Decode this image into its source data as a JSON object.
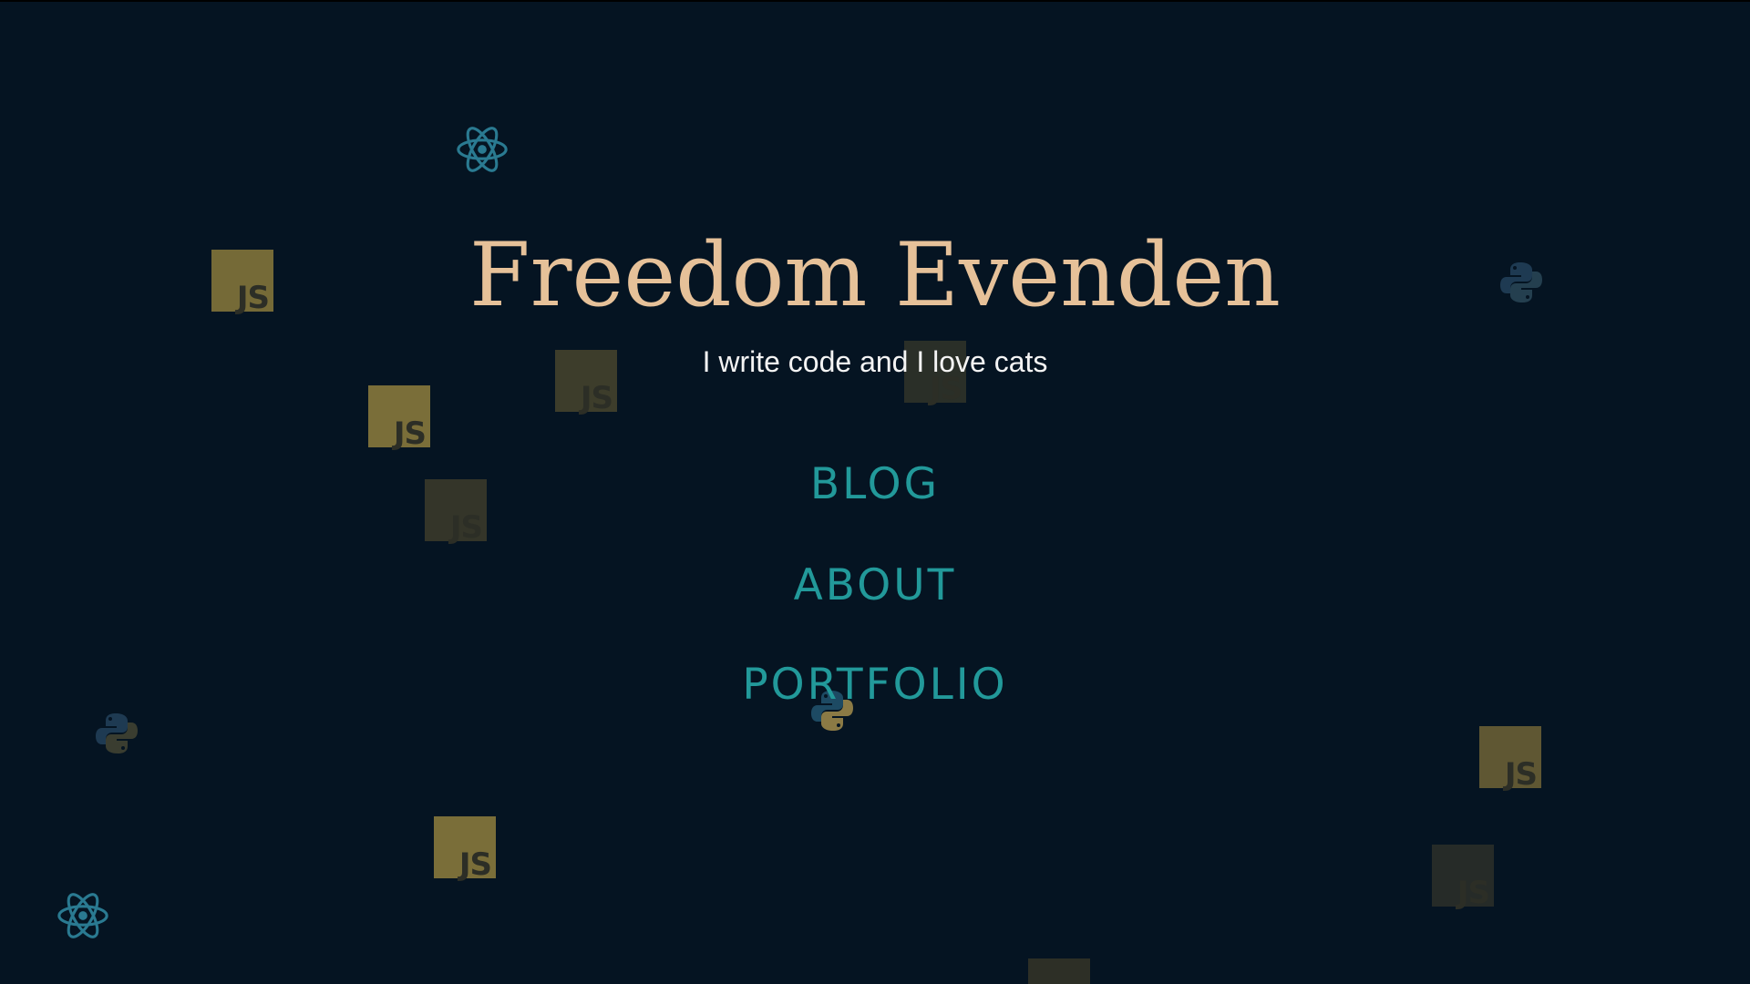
{
  "page": {
    "background_color": "#051422"
  },
  "header": {
    "title": "Freedom Evenden",
    "tagline": "I write code and I love cats"
  },
  "nav": {
    "items": [
      {
        "label": "BLOG"
      },
      {
        "label": "ABOUT"
      },
      {
        "label": "PORTFOLIO"
      }
    ]
  },
  "background_icons": {
    "js_badge_text": "JS",
    "icon_names": [
      "react-icon",
      "javascript-icon",
      "python-icon"
    ]
  },
  "colors": {
    "title": "#e6c199",
    "tagline": "#f4f4f4",
    "nav_link": "#22999a",
    "react_icon": "#2a7a91",
    "python_blue": "#1e3a52",
    "python_yellow": "#8b7a45",
    "js_text": "#2c2e26"
  }
}
